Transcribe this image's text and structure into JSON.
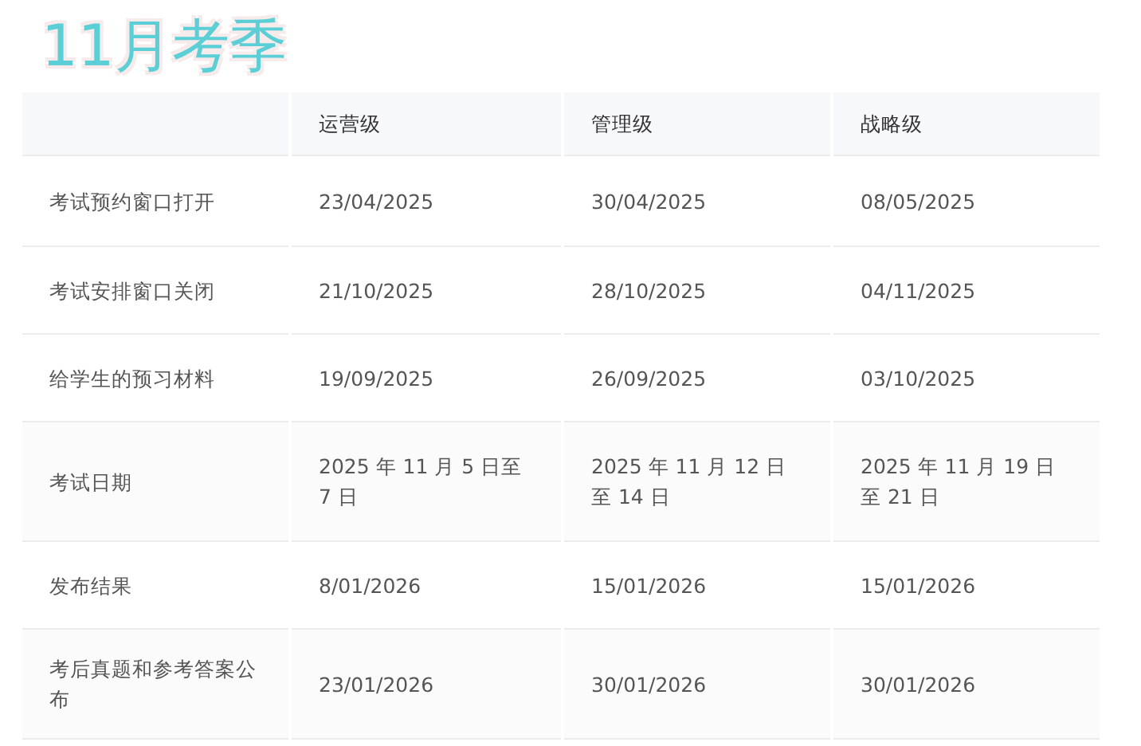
{
  "title": "11月考季",
  "table": {
    "columns": [
      "",
      "运营级",
      "管理级",
      "战略级"
    ],
    "rows": [
      [
        "考试预约窗口打开",
        "23/04/2025",
        "30/04/2025",
        "08/05/2025"
      ],
      [
        "考试安排窗口关闭",
        "21/10/2025",
        "28/10/2025",
        "04/11/2025"
      ],
      [
        "给学生的预习材料",
        "19/09/2025",
        "26/09/2025",
        "03/10/2025"
      ],
      [
        "考试日期",
        "2025 年 11 月 5 日至 7 日",
        "2025 年 11 月 12 日至 14 日",
        "2025 年 11 月 19 日至 21 日"
      ],
      [
        "发布结果",
        "8/01/2026",
        "15/01/2026",
        "15/01/2026"
      ],
      [
        "考后真题和参考答案公布",
        "23/01/2026",
        "30/01/2026",
        "30/01/2026"
      ]
    ]
  }
}
